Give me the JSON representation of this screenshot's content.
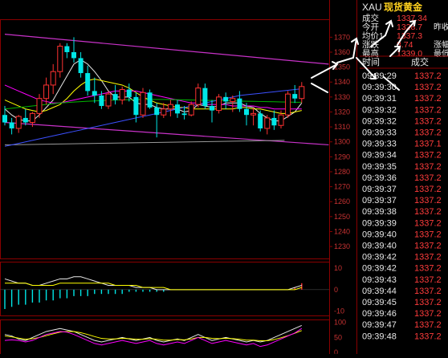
{
  "symbol": {
    "code": "XAU",
    "name": "现货黄金"
  },
  "quote_rows": [
    {
      "label": "成交",
      "value": "1337.34",
      "extra": ""
    },
    {
      "label": "今开",
      "value": "1328.7",
      "extra": "昨收"
    },
    {
      "label": "均价1",
      "value": "1337.3",
      "extra": ""
    },
    {
      "label": "涨跌",
      "value": "8.74",
      "extra": "涨幅"
    },
    {
      "label": "最高",
      "value": "1339.0",
      "extra": "最低"
    }
  ],
  "tick_header": {
    "time": "时间",
    "price": "成交"
  },
  "ticks": [
    {
      "time": "09:39:29",
      "price": "1337.2"
    },
    {
      "time": "09:39:30",
      "price": "1337.2"
    },
    {
      "time": "09:39:31",
      "price": "1337.2"
    },
    {
      "time": "09:39:32",
      "price": "1337.2"
    },
    {
      "time": "09:39:32",
      "price": "1337.2"
    },
    {
      "time": "09:39:33",
      "price": "1337.2"
    },
    {
      "time": "09:39:33",
      "price": "1337.1"
    },
    {
      "time": "09:39:34",
      "price": "1337.2"
    },
    {
      "time": "09:39:35",
      "price": "1337.2"
    },
    {
      "time": "09:39:36",
      "price": "1337.2"
    },
    {
      "time": "09:39:37",
      "price": "1337.2"
    },
    {
      "time": "09:39:37",
      "price": "1337.2"
    },
    {
      "time": "09:39:38",
      "price": "1337.2"
    },
    {
      "time": "09:39:39",
      "price": "1337.2"
    },
    {
      "time": "09:39:40",
      "price": "1337.2"
    },
    {
      "time": "09:39:40",
      "price": "1337.2"
    },
    {
      "time": "09:39:42",
      "price": "1337.2"
    },
    {
      "time": "09:39:42",
      "price": "1337.2"
    },
    {
      "time": "09:39:43",
      "price": "1337.2"
    },
    {
      "time": "09:39:44",
      "price": "1337.2"
    },
    {
      "time": "09:39:45",
      "price": "1337.2"
    },
    {
      "time": "09:39:46",
      "price": "1337.2"
    },
    {
      "time": "09:39:47",
      "price": "1337.2"
    },
    {
      "time": "09:39:48",
      "price": "1337.2"
    }
  ],
  "colors": {
    "up": "#ff3232",
    "down": "#00e6e6",
    "grid_red": "#8a0000",
    "axis_text": "#c83232",
    "text_white": "#e8e8e8",
    "price_red": "#ff3c3c",
    "title_yellow": "#ffd21e",
    "ma5": "#e8e8e8",
    "ma10": "#ffff00",
    "ma20": "#ff00ff",
    "ma60": "#00b400",
    "ma120": "#3c50ff",
    "channel": "#c832c8"
  },
  "chart_data": [
    {
      "type": "candlestick",
      "title": "",
      "ylim": [
        1222,
        1382
      ],
      "yticks": [
        1230,
        1240,
        1250,
        1260,
        1270,
        1280,
        1290,
        1300,
        1310,
        1320,
        1330,
        1340,
        1350,
        1360,
        1370
      ],
      "candles": [
        {
          "o": 1318,
          "h": 1324,
          "l": 1311,
          "c": 1313
        },
        {
          "o": 1313,
          "h": 1316,
          "l": 1305,
          "c": 1309
        },
        {
          "o": 1309,
          "h": 1318,
          "l": 1306,
          "c": 1317
        },
        {
          "o": 1316,
          "h": 1322,
          "l": 1311,
          "c": 1313
        },
        {
          "o": 1313,
          "h": 1320,
          "l": 1310,
          "c": 1319
        },
        {
          "o": 1319,
          "h": 1332,
          "l": 1316,
          "c": 1329
        },
        {
          "o": 1329,
          "h": 1343,
          "l": 1325,
          "c": 1338
        },
        {
          "o": 1338,
          "h": 1352,
          "l": 1332,
          "c": 1347
        },
        {
          "o": 1347,
          "h": 1366,
          "l": 1343,
          "c": 1364
        },
        {
          "o": 1364,
          "h": 1366,
          "l": 1356,
          "c": 1360
        },
        {
          "o": 1360,
          "h": 1370,
          "l": 1353,
          "c": 1356
        },
        {
          "o": 1356,
          "h": 1360,
          "l": 1343,
          "c": 1346
        },
        {
          "o": 1346,
          "h": 1351,
          "l": 1331,
          "c": 1334
        },
        {
          "o": 1334,
          "h": 1343,
          "l": 1326,
          "c": 1331
        },
        {
          "o": 1331,
          "h": 1334,
          "l": 1322,
          "c": 1324
        },
        {
          "o": 1324,
          "h": 1334,
          "l": 1322,
          "c": 1332
        },
        {
          "o": 1332,
          "h": 1338,
          "l": 1325,
          "c": 1328
        },
        {
          "o": 1328,
          "h": 1337,
          "l": 1325,
          "c": 1335
        },
        {
          "o": 1335,
          "h": 1339,
          "l": 1327,
          "c": 1330
        },
        {
          "o": 1330,
          "h": 1333,
          "l": 1313,
          "c": 1318
        },
        {
          "o": 1318,
          "h": 1336,
          "l": 1316,
          "c": 1333
        },
        {
          "o": 1333,
          "h": 1335,
          "l": 1322,
          "c": 1323
        },
        {
          "o": 1323,
          "h": 1326,
          "l": 1303,
          "c": 1318
        },
        {
          "o": 1318,
          "h": 1326,
          "l": 1316,
          "c": 1322
        },
        {
          "o": 1322,
          "h": 1328,
          "l": 1317,
          "c": 1325
        },
        {
          "o": 1325,
          "h": 1328,
          "l": 1316,
          "c": 1319
        },
        {
          "o": 1319,
          "h": 1324,
          "l": 1315,
          "c": 1318
        },
        {
          "o": 1318,
          "h": 1327,
          "l": 1317,
          "c": 1325
        },
        {
          "o": 1325,
          "h": 1339,
          "l": 1323,
          "c": 1336
        },
        {
          "o": 1336,
          "h": 1339,
          "l": 1322,
          "c": 1324
        },
        {
          "o": 1324,
          "h": 1328,
          "l": 1313,
          "c": 1321
        },
        {
          "o": 1321,
          "h": 1332,
          "l": 1319,
          "c": 1330
        },
        {
          "o": 1330,
          "h": 1333,
          "l": 1322,
          "c": 1327
        },
        {
          "o": 1327,
          "h": 1331,
          "l": 1320,
          "c": 1329
        },
        {
          "o": 1329,
          "h": 1334,
          "l": 1320,
          "c": 1322
        },
        {
          "o": 1322,
          "h": 1326,
          "l": 1311,
          "c": 1318
        },
        {
          "o": 1318,
          "h": 1323,
          "l": 1311,
          "c": 1319
        },
        {
          "o": 1319,
          "h": 1321,
          "l": 1307,
          "c": 1309
        },
        {
          "o": 1309,
          "h": 1318,
          "l": 1305,
          "c": 1316
        },
        {
          "o": 1316,
          "h": 1321,
          "l": 1308,
          "c": 1311
        },
        {
          "o": 1311,
          "h": 1321,
          "l": 1309,
          "c": 1318
        },
        {
          "o": 1318,
          "h": 1334,
          "l": 1316,
          "c": 1332
        },
        {
          "o": 1332,
          "h": 1338,
          "l": 1326,
          "c": 1329
        },
        {
          "o": 1329,
          "h": 1340,
          "l": 1326,
          "c": 1337
        }
      ],
      "ma_lines": [
        {
          "name": "MA5",
          "color": "#e8e8e8",
          "values": [
            1322,
            1318,
            1315,
            1314,
            1314,
            1318,
            1323,
            1328,
            1336,
            1344,
            1352,
            1355,
            1352,
            1347,
            1341,
            1334,
            1330,
            1330,
            1330,
            1326,
            1325,
            1325,
            1323,
            1322,
            1322,
            1322,
            1320,
            1321,
            1325,
            1324,
            1323,
            1324,
            1326,
            1326,
            1326,
            1324,
            1323,
            1319,
            1316,
            1314,
            1314,
            1317,
            1320,
            1326
          ]
        },
        {
          "name": "MA10",
          "color": "#ffff00",
          "values": [
            1328,
            1326,
            1324,
            1322,
            1321,
            1320,
            1321,
            1323,
            1325,
            1329,
            1334,
            1338,
            1341,
            1342,
            1341,
            1340,
            1339,
            1338,
            1336,
            1333,
            1330,
            1328,
            1326,
            1325,
            1324,
            1323,
            1323,
            1322,
            1322,
            1322,
            1322,
            1322,
            1322,
            1322,
            1323,
            1323,
            1322,
            1322,
            1321,
            1320,
            1319,
            1319,
            1320,
            1321
          ]
        },
        {
          "name": "MA20",
          "color": "#ff00ff",
          "values": [
            1338,
            1336,
            1334,
            1332,
            1330,
            1328,
            1327,
            1326,
            1326,
            1327,
            1328,
            1329,
            1330,
            1331,
            1332,
            1333,
            1334,
            1334,
            1334,
            1334,
            1333,
            1332,
            1331,
            1330,
            1329,
            1328,
            1327,
            1326,
            1326,
            1325,
            1325,
            1325,
            1325,
            1324,
            1324,
            1324,
            1324,
            1323,
            1323,
            1322,
            1322,
            1322,
            1322,
            1322
          ]
        },
        {
          "name": "MA60",
          "color": "#00b400",
          "values": [
            1322,
            1322.5,
            1323,
            1323.5,
            1324,
            1324.5,
            1325,
            1325.5,
            1326,
            1326.3,
            1326.6,
            1326.9,
            1327.2,
            1327.4,
            1327.6,
            1327.8,
            1328,
            1328.1,
            1328.2,
            1328.3,
            1328.4,
            1328.4,
            1328.4,
            1328.4,
            1328.3,
            1328.2,
            1328.1,
            1328,
            1327.9,
            1327.8,
            1327.7,
            1327.6,
            1327.5,
            1327.4,
            1327.3,
            1327.2,
            1327.1,
            1327,
            1326.9,
            1326.8,
            1326.7,
            1326.6,
            1326.5,
            1326.5
          ]
        },
        {
          "name": "MA120",
          "color": "#3c50ff",
          "values": [
            1297,
            1298,
            1299,
            1300,
            1301,
            1302,
            1303,
            1304,
            1305,
            1306,
            1307,
            1308,
            1309,
            1310,
            1311,
            1312,
            1313,
            1314,
            1315,
            1316,
            1317,
            1318,
            1319,
            1320,
            1321,
            1322,
            1323,
            1324,
            1325,
            1326,
            1327,
            1328,
            1329,
            1330,
            1331,
            1331.5,
            1332,
            1332.5,
            1333,
            1333.5,
            1334,
            1334.5,
            1335,
            1335.5
          ]
        }
      ],
      "channel_lines": [
        {
          "from": [
            0,
            1372
          ],
          "to": [
            44,
            1352
          ]
        },
        {
          "from": [
            0,
            1313
          ],
          "to": [
            44,
            1298
          ]
        }
      ],
      "base_line": {
        "from": [
          0,
          1298
        ],
        "to": [
          44,
          1301
        ]
      }
    },
    {
      "type": "bar",
      "title": "",
      "yticks": [
        10,
        0,
        -10
      ],
      "ylim": [
        -12,
        13
      ],
      "values": [
        -9,
        -8,
        -7,
        -7,
        -6,
        -6,
        -5,
        -5,
        -4,
        -4,
        -3,
        -3,
        -3,
        -2,
        -2,
        -2,
        -2,
        -2,
        -1,
        -1,
        -1,
        -1,
        -1,
        -1,
        0,
        0,
        0,
        0,
        0,
        0,
        0,
        0,
        0,
        0,
        0,
        0,
        0,
        0,
        0,
        0,
        0,
        0,
        1,
        3
      ],
      "lines": [
        {
          "name": "DIF",
          "color": "#e8e8e8",
          "values": [
            5,
            4,
            3,
            3,
            2,
            2,
            3,
            4,
            5,
            5,
            6,
            6,
            5,
            4,
            3,
            2,
            2,
            2,
            2,
            1,
            1,
            1,
            0,
            0,
            0,
            0,
            0,
            0,
            0,
            0,
            0,
            0,
            0,
            0,
            0,
            0,
            0,
            0,
            0,
            0,
            0,
            0,
            1,
            2
          ]
        },
        {
          "name": "DEA",
          "color": "#ffff00",
          "values": [
            3,
            3,
            3,
            3,
            2,
            2,
            2,
            2,
            3,
            3,
            3,
            3,
            3,
            3,
            3,
            3,
            2,
            2,
            2,
            2,
            1,
            1,
            1,
            1,
            0,
            0,
            0,
            0,
            0,
            0,
            0,
            0,
            0,
            0,
            0,
            0,
            0,
            0,
            0,
            0,
            0,
            0,
            0,
            1
          ]
        }
      ]
    },
    {
      "type": "line",
      "title": "",
      "yticks": [
        100,
        50,
        0
      ],
      "ylim": [
        -5,
        110
      ],
      "series": [
        {
          "color": "#e8e8e8",
          "values": [
            60,
            55,
            45,
            40,
            50,
            60,
            70,
            75,
            80,
            75,
            70,
            60,
            50,
            40,
            35,
            40,
            45,
            50,
            45,
            40,
            45,
            50,
            40,
            35,
            40,
            45,
            40,
            50,
            60,
            50,
            40,
            45,
            50,
            45,
            40,
            35,
            40,
            35,
            40,
            50,
            60,
            70,
            80,
            90
          ]
        },
        {
          "color": "#ffff00",
          "values": [
            55,
            52,
            48,
            44,
            46,
            50,
            56,
            62,
            68,
            70,
            70,
            66,
            60,
            53,
            47,
            45,
            45,
            47,
            46,
            44,
            44,
            46,
            44,
            41,
            41,
            43,
            42,
            45,
            50,
            50,
            47,
            46,
            47,
            46,
            44,
            41,
            41,
            39,
            39,
            43,
            49,
            56,
            64,
            73
          ]
        },
        {
          "color": "#ff00ff",
          "values": [
            40,
            42,
            40,
            35,
            40,
            50,
            60,
            65,
            70,
            68,
            60,
            50,
            40,
            30,
            25,
            30,
            35,
            40,
            35,
            30,
            35,
            40,
            30,
            25,
            30,
            35,
            30,
            40,
            50,
            40,
            30,
            35,
            40,
            35,
            30,
            25,
            30,
            20,
            25,
            35,
            45,
            55,
            65,
            80
          ]
        }
      ]
    }
  ]
}
